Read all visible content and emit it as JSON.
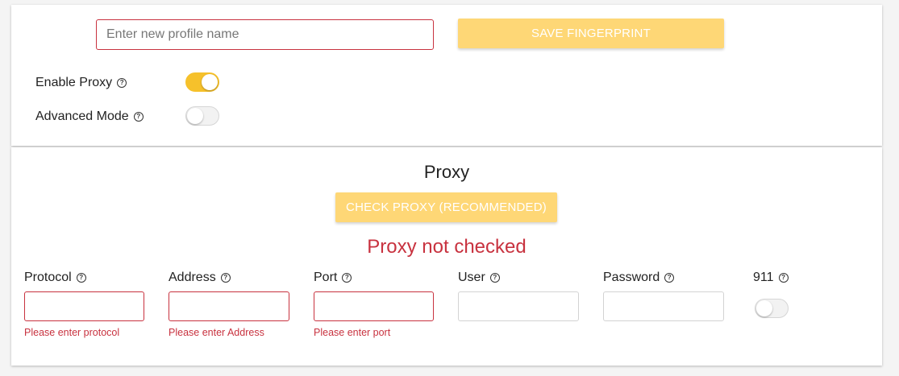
{
  "profile": {
    "name_value": "",
    "name_placeholder": "Enter new profile name",
    "save_label": "SAVE FINGERPRINT"
  },
  "settings": {
    "enable_proxy": {
      "label": "Enable Proxy",
      "on": true
    },
    "advanced_mode": {
      "label": "Advanced Mode",
      "on": false
    }
  },
  "proxy": {
    "title": "Proxy",
    "check_label": "CHECK PROXY (RECOMMENDED)",
    "status": "Proxy not checked",
    "fields": {
      "protocol": {
        "label": "Protocol",
        "value": "",
        "error": "Please enter protocol"
      },
      "address": {
        "label": "Address",
        "value": "",
        "error": "Please enter Address"
      },
      "port": {
        "label": "Port",
        "value": "",
        "error": "Please enter port"
      },
      "user": {
        "label": "User",
        "value": ""
      },
      "password": {
        "label": "Password",
        "value": ""
      },
      "911": {
        "label": "911",
        "on": false
      }
    }
  },
  "colors": {
    "accent_yellow": "#fed776",
    "toggle_on": "#f6c12b",
    "error_red": "#c8323f"
  },
  "icons": {
    "help": "question-circle-icon"
  }
}
